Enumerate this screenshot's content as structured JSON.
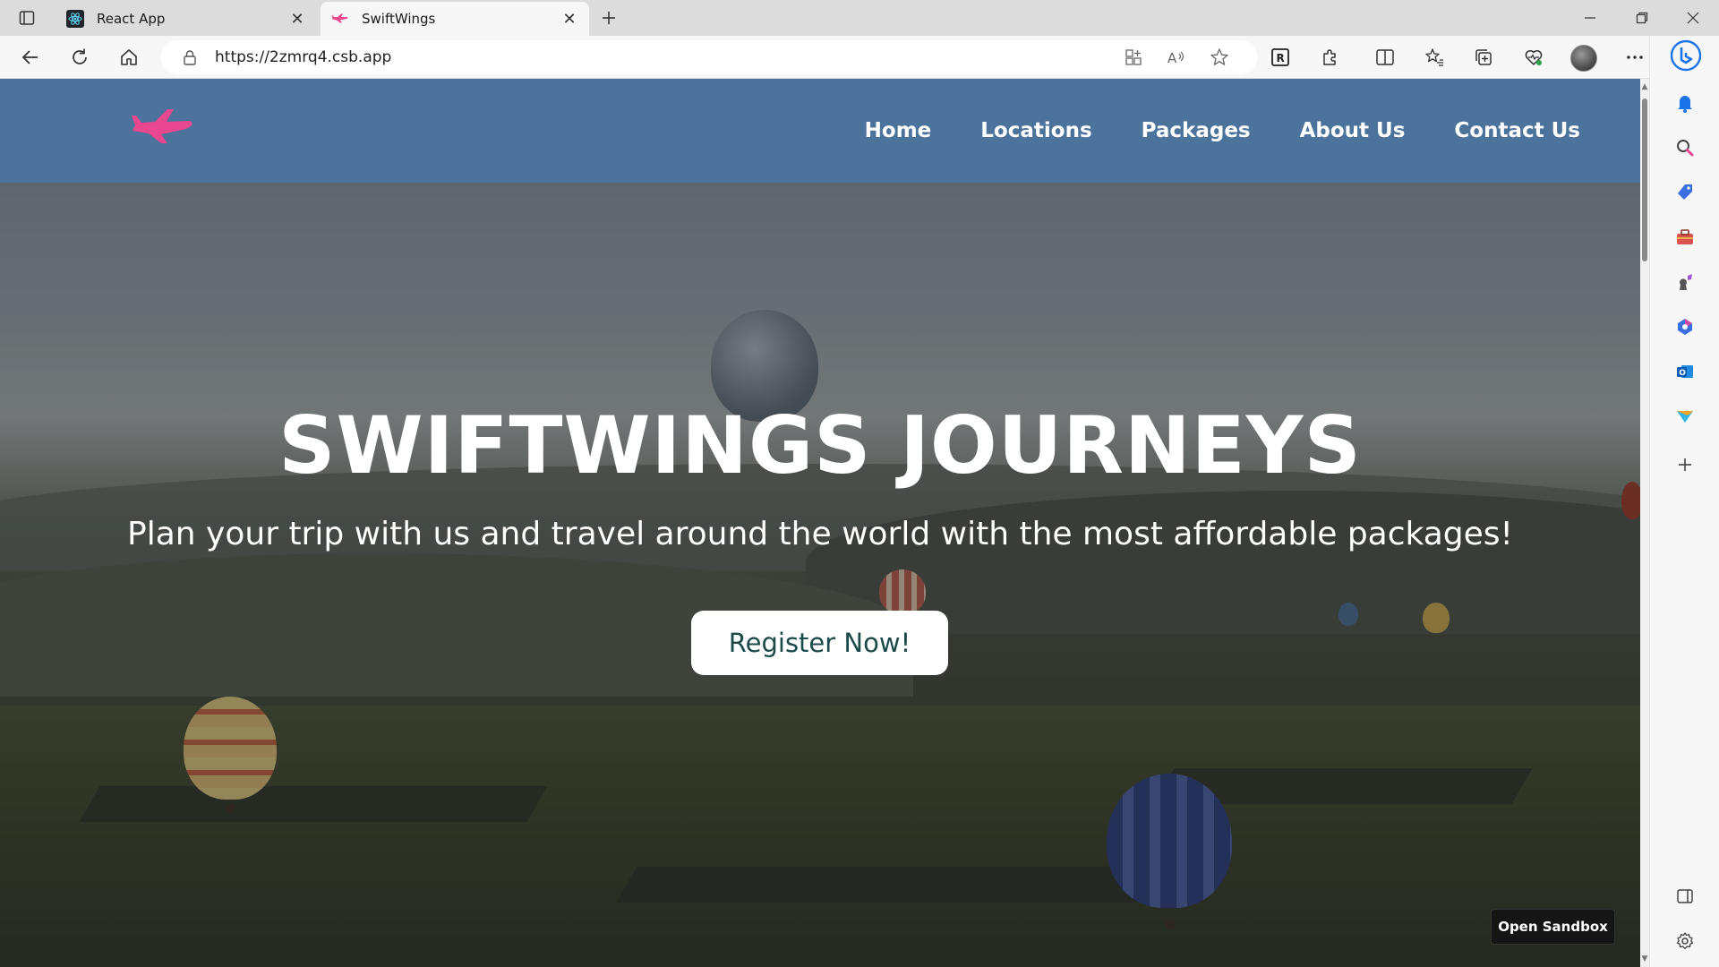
{
  "browser": {
    "tabs": [
      {
        "title": "React App",
        "favicon": "react-icon"
      },
      {
        "title": "SwiftWings",
        "favicon": "plane-icon"
      }
    ],
    "address": {
      "url": "https://2zmrq4.csb.app"
    },
    "accent_color": "#0a66c2"
  },
  "site": {
    "nav_bg_color": "#4b739b",
    "logo_color": "#e9478f",
    "nav": {
      "home": "Home",
      "locations": "Locations",
      "packages": "Packages",
      "about": "About Us",
      "contact": "Contact Us"
    },
    "hero": {
      "title": "SWIFTWINGS JOURNEYS",
      "subtitle": "Plan your trip with us and travel around the world with the most affordable packages!",
      "cta_label": "Register Now!"
    }
  },
  "sandbox": {
    "open_label": "Open Sandbox"
  }
}
